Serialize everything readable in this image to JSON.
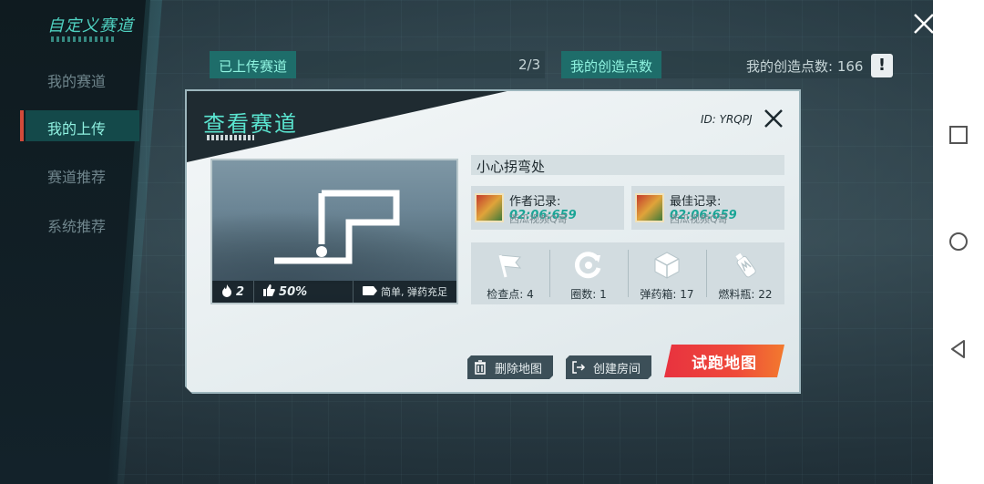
{
  "sidebar": {
    "title": "自定义赛道",
    "items": [
      {
        "label": "我的赛道"
      },
      {
        "label": "我的上传"
      },
      {
        "label": "赛道推荐"
      },
      {
        "label": "系统推荐"
      }
    ]
  },
  "topbar": {
    "uploaded_label": "已上传赛道",
    "uploaded_count": "2/3",
    "creation_points_tab": "我的创造点数",
    "creation_points_text": "我的创造点数: 166",
    "warn_icon": "!"
  },
  "modal": {
    "title": "查看赛道",
    "id_text": "ID: YRQPJ",
    "track_name": "小心拐弯处",
    "thumb": {
      "heat": "2",
      "like_rate": "50%",
      "tag": "简单, 弹药充足"
    },
    "author_record": {
      "label": "作者记录: ",
      "time": "02:06:659",
      "player": "西瓜视频Q哥"
    },
    "best_record": {
      "label": "最佳记录: ",
      "time": "02:06:659",
      "player": "西瓜视频Q哥"
    },
    "stats": [
      {
        "icon": "flag-icon",
        "label": "检查点: 4"
      },
      {
        "icon": "lap-icon",
        "label": "圈数: 1"
      },
      {
        "icon": "ammo-box-icon",
        "label": "弹药箱: 17"
      },
      {
        "icon": "fuel-bottle-icon",
        "label": "燃料瓶: 22"
      }
    ],
    "buttons": {
      "delete": "删除地图",
      "create_room": "创建房间",
      "test_run": "试跑地图"
    }
  },
  "colors": {
    "accent": "#5ae5d0",
    "primary_button": "#ef4a3a",
    "record_time": "#1aa596"
  }
}
